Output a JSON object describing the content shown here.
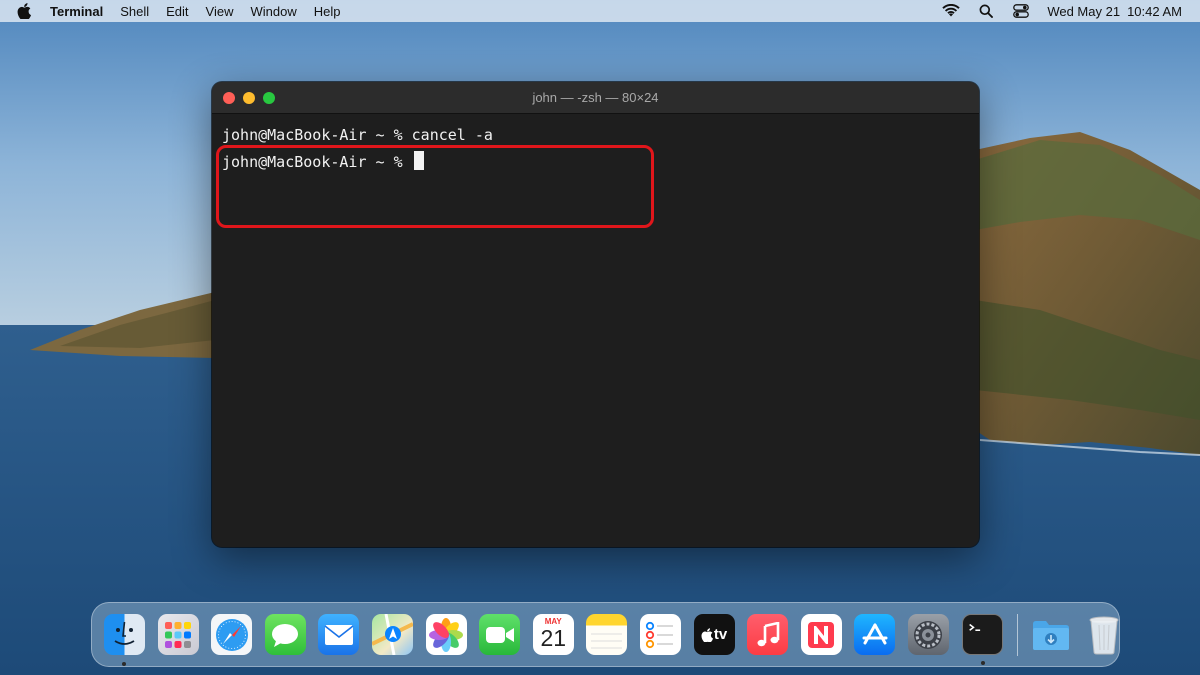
{
  "menubar": {
    "apple_icon": "apple-icon",
    "app_name": "Terminal",
    "menus": [
      "Shell",
      "Edit",
      "View",
      "Window",
      "Help"
    ],
    "status_icons": [
      "wifi-icon",
      "search-icon",
      "control-center-icon"
    ],
    "date": "Wed May 21",
    "time": "10:42 AM"
  },
  "terminal": {
    "title": "john — -zsh — 80×24",
    "lines": [
      "john@MacBook-Air ~ % cancel -a",
      "john@MacBook-Air ~ % "
    ],
    "highlight_color": "#e0161b"
  },
  "dock": {
    "calendar": {
      "month": "MAY",
      "day": "21"
    },
    "tv_label": "tv",
    "apps": [
      "finder-icon",
      "launchpad-icon",
      "safari-icon",
      "messages-icon",
      "mail-icon",
      "maps-icon",
      "photos-icon",
      "facetime-icon",
      "calendar-icon",
      "notes-icon",
      "reminders-icon",
      "apple-tv-icon",
      "music-icon",
      "news-icon",
      "app-store-icon",
      "system-preferences-icon",
      "terminal-icon",
      "downloads-folder-icon",
      "trash-icon"
    ]
  }
}
